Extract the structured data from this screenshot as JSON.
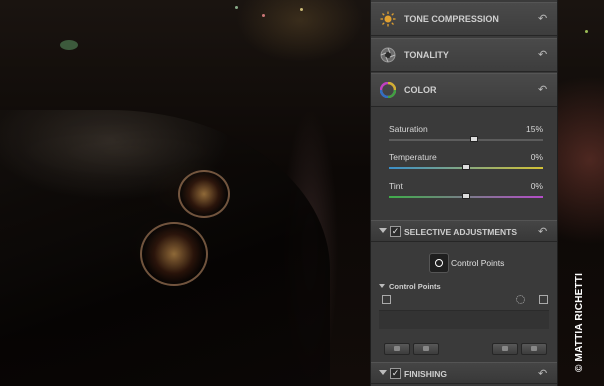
{
  "panel": {
    "sections": [
      {
        "label": "TONE COMPRESSION",
        "icon": "sun-icon"
      },
      {
        "label": "TONALITY",
        "icon": "aperture-icon"
      },
      {
        "label": "COLOR",
        "icon": "color-wheel-icon"
      }
    ],
    "color_sliders": [
      {
        "label": "Saturation",
        "value": "15%",
        "position": 0.55
      },
      {
        "label": "Temperature",
        "value": "0%",
        "position": 0.5
      },
      {
        "label": "Tint",
        "value": "0%",
        "position": 0.5
      }
    ],
    "selective_adjustments": {
      "label": "SELECTIVE ADJUSTMENTS",
      "checked": "✓",
      "control_points_button": "Control Points",
      "list_header": "Control Points"
    },
    "finishing": {
      "label": "FINISHING",
      "checked": "✓"
    },
    "colors": {
      "panel_bg": "#3a3a3a",
      "header_bg": "#444444",
      "text": "#cfcfcf",
      "temperature_track_start": "#3a8fc9",
      "temperature_track_end": "#d3c235",
      "tint_track_start": "#3fae4a",
      "tint_track_end": "#b44cc8"
    }
  },
  "watermark": "© MATTIA RICHETTI"
}
